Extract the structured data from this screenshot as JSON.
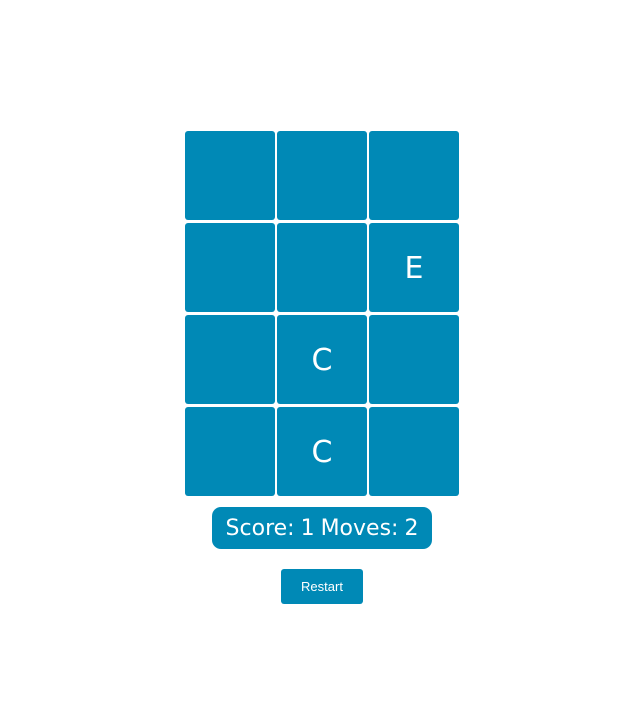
{
  "board": {
    "rows": [
      [
        "",
        "",
        ""
      ],
      [
        "",
        "",
        "E"
      ],
      [
        "",
        "C",
        ""
      ],
      [
        "",
        "C",
        ""
      ]
    ]
  },
  "status": {
    "score_label": "Score:",
    "score_value": "1",
    "moves_label": "Moves:",
    "moves_value": "2"
  },
  "controls": {
    "restart_label": "Restart"
  },
  "colors": {
    "tile": "#0089b6",
    "tile_text": "#ffffff",
    "background": "#ffffff"
  }
}
